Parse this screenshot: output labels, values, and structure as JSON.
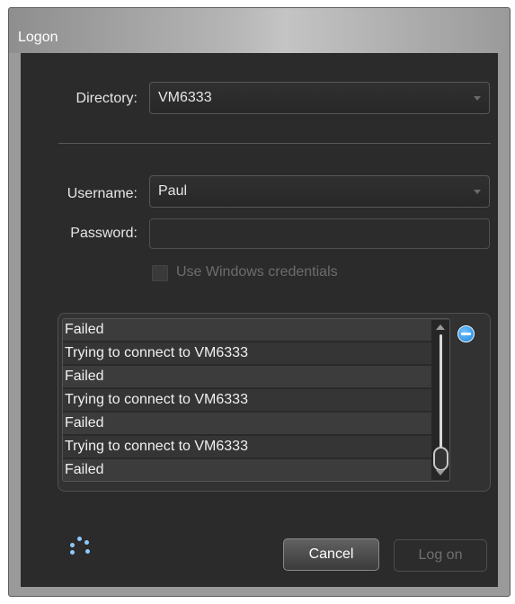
{
  "window": {
    "title": "Logon"
  },
  "directory": {
    "label": "Directory:",
    "value": "VM6333"
  },
  "username": {
    "label": "Username:",
    "value": "Paul"
  },
  "password": {
    "label": "Password:",
    "value": ""
  },
  "windows_credentials": {
    "label": "Use Windows credentials",
    "checked": false,
    "enabled": false
  },
  "log": {
    "items": [
      "Failed",
      "Trying to connect to VM6333",
      "Failed",
      "Trying to connect to VM6333",
      "Failed",
      "Trying to connect to VM6333",
      "Failed"
    ]
  },
  "buttons": {
    "cancel": "Cancel",
    "logon": "Log on"
  },
  "icons": {
    "remove": "minus-circle-icon",
    "busy": "loading-spinner-icon"
  },
  "colors": {
    "accent": "#1f86df"
  }
}
